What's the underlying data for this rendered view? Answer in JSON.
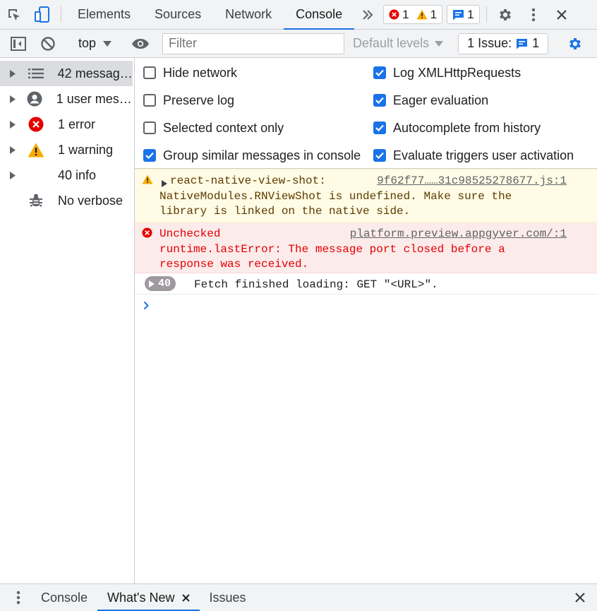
{
  "top_tabs": {
    "tabs": [
      "Elements",
      "Sources",
      "Network",
      "Console"
    ],
    "error_count": "1",
    "warning_count": "1",
    "message_count": "1"
  },
  "toolbar": {
    "context": "top",
    "filter_placeholder": "Filter",
    "levels": "Default levels",
    "issues_label": "1 Issue:",
    "issues_count": "1"
  },
  "sidebar": {
    "items": [
      {
        "label": "42 messages"
      },
      {
        "label": "1 user mess…"
      },
      {
        "label": "1 error"
      },
      {
        "label": "1 warning"
      },
      {
        "label": "40 info"
      },
      {
        "label": "No verbose"
      }
    ]
  },
  "settings": [
    {
      "label": "Hide network",
      "checked": false
    },
    {
      "label": "Log XMLHttpRequests",
      "checked": true
    },
    {
      "label": "Preserve log",
      "checked": false
    },
    {
      "label": "Eager evaluation",
      "checked": true
    },
    {
      "label": "Selected context only",
      "checked": false
    },
    {
      "label": "Autocomplete from history",
      "checked": true
    },
    {
      "label": "Group similar messages in console",
      "checked": true
    },
    {
      "label": "Evaluate triggers user activation",
      "checked": true
    }
  ],
  "messages": {
    "warning": {
      "text": "react-native-view-shot:\nNativeModules.RNViewShot is undefined. Make sure the\nlibrary is linked on the native side.",
      "source": "9f62f77……31c98525278677.js:1"
    },
    "error": {
      "text": "Unchecked\nruntime.lastError: The message port closed before a\nresponse was received.",
      "source": "platform.preview.appgyver.com/:1"
    },
    "info": {
      "repeat": "40",
      "text": "Fetch finished loading: GET \"<URL>\"."
    }
  },
  "drawer": {
    "tabs": [
      "Console",
      "What's New",
      "Issues"
    ]
  },
  "colors": {
    "accent": "#1a73e8",
    "error": "#e50000",
    "warning": "#f9ab00"
  }
}
